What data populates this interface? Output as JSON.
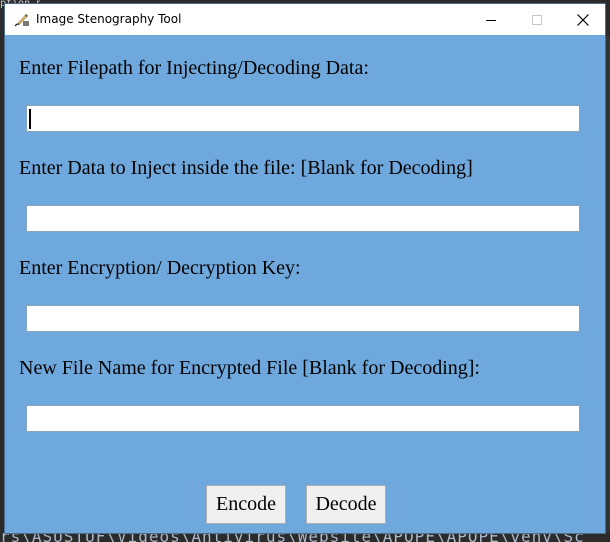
{
  "window": {
    "title": "Image Stenography Tool"
  },
  "form": {
    "filepath_label": "Enter Filepath for Injecting/Decoding Data:",
    "filepath_value": "",
    "data_label": "Enter Data to Inject inside the file: [Blank for Decoding]",
    "data_value": "",
    "key_label": "Enter Encryption/ Decryption Key:",
    "key_value": "",
    "newname_label": "New File Name for Encrypted File [Blank for Decoding]:",
    "newname_value": ""
  },
  "buttons": {
    "encode": "Encode",
    "decode": "Decode"
  },
  "background": {
    "top_text": "ption.py",
    "bottom_text": "rs\\ASUSTUF\\Videos\\Antivirus\\Website\\APOPE\\APOPE\\venv\\Sc"
  },
  "colors": {
    "client_bg": "#6fa8dc",
    "titlebar_bg": "#ffffff"
  },
  "icons": {
    "app": "feather-quill-icon",
    "minimize": "minimize-icon",
    "maximize": "maximize-icon",
    "close": "close-icon"
  }
}
